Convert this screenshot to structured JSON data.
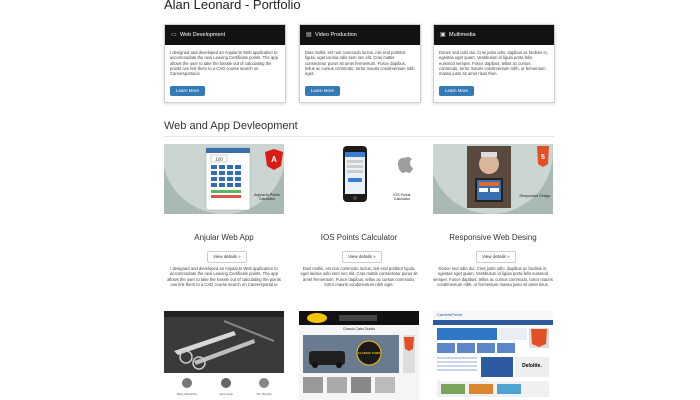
{
  "header": {
    "title": "Alan Leonard - Portfolio"
  },
  "panels": [
    {
      "icon": "desktop-icon",
      "heading": "Web Development",
      "text": "I designed and developed an AnjularJs Web application to accommodate the new Leaving Certificate points. The app allows the user to take the hassle out of calculating the points can link them to a CAD course search on Careersportal.ie",
      "button": "Learn More"
    },
    {
      "icon": "film-icon",
      "heading": "Video Production",
      "text": "Duis mollis, est non commodo luctus, nisi erat porttitor ligula, eget lacinia odio sem nec elit. Cras mattis consectetur purus sit amet fermentum. Fusce dapibus, tellus ac cursus commodo, tortor mauris condimentum nibh eget.",
      "button": "Learn More"
    },
    {
      "icon": "picture-icon",
      "heading": "Multimedia",
      "text": "Donec sed odio dui. Cras justo odio, dapibus ac facilisis in, egestas eget quam. Vestibulum id ligula porta felis euismod semper. Fusce dapibus, tellus ac cursus commodo, tortor mauris condimentum nibh, ut fermentum massa justo sit amet risus then.",
      "button": "Learn More"
    }
  ],
  "section": {
    "title": "Web and App Devleopment"
  },
  "projects": [
    {
      "title": "Anjular Web App",
      "thumb_caption": "AnjularJs Points Calculator",
      "button": "View details »",
      "text": "I designed and developed an AnjularJs Web application to accommodate the new Leaving Certificate points. The app allows the user to take the hassle out of calculating the points can link them to a CAD course search on Careersportal.ie"
    },
    {
      "title": "IOS Points Calculator",
      "thumb_caption": "IOS Points Calculator",
      "button": "View details »",
      "text": "Duis mollis, est non commodo luctus, nisi erat porttitor ligula, eget lacinia odio sem nec elit. Cras mattis consectetur purus sit amet fermentum. Fusce dapibus, tellus ac cursus commodo, tortor mauris condimentum nibh eget."
    },
    {
      "title": "Responsive Web Desing",
      "thumb_caption": "Responsive Design",
      "button": "View details »",
      "text": "Donec sed odio dui. Cras justo odio, dapibus ac facilisis in, egestas eget quam. Vestibulum id ligula porta felis euismod semper. Fusce dapibus, tellus ac cursus commodo, tortor mauris condimentum nibh, ut fermentum massa justo sit amet risus."
    }
  ],
  "app_screen": {
    "value": "120",
    "badge": "5"
  },
  "html5_badge": "HTML 5",
  "shots": [
    {
      "names": [
        "Mary McCarthy",
        "Jane Kelly",
        "Tim Murphy"
      ]
    },
    {
      "banner": "Classic Cabs Dublin",
      "logo_text": "CLASSIC CABS"
    },
    {
      "banner": "CareersPortal",
      "logo_text": "Deloitte."
    }
  ]
}
